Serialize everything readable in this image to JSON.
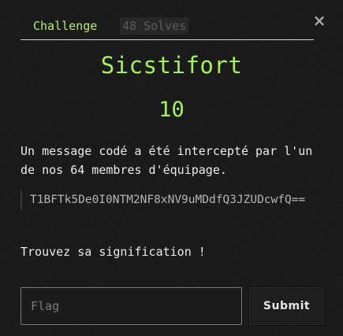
{
  "modal": {
    "close_label": "×",
    "tabs": [
      {
        "label": "Challenge"
      },
      {
        "label": "48 Solves"
      }
    ],
    "challenge": {
      "name": "Sicstifort",
      "points": "10",
      "description": "Un message codé a été intercepté par l'un de nos 64 membres d'équipage.",
      "encoded_message": "T1BFTk5De0I0NTM2NF8xNV9uMDdfQ3JZUDcwfQ==",
      "question": "Trouvez sa signification !"
    },
    "form": {
      "flag_placeholder": "Flag",
      "flag_value": "",
      "submit_label": "Submit"
    }
  }
}
